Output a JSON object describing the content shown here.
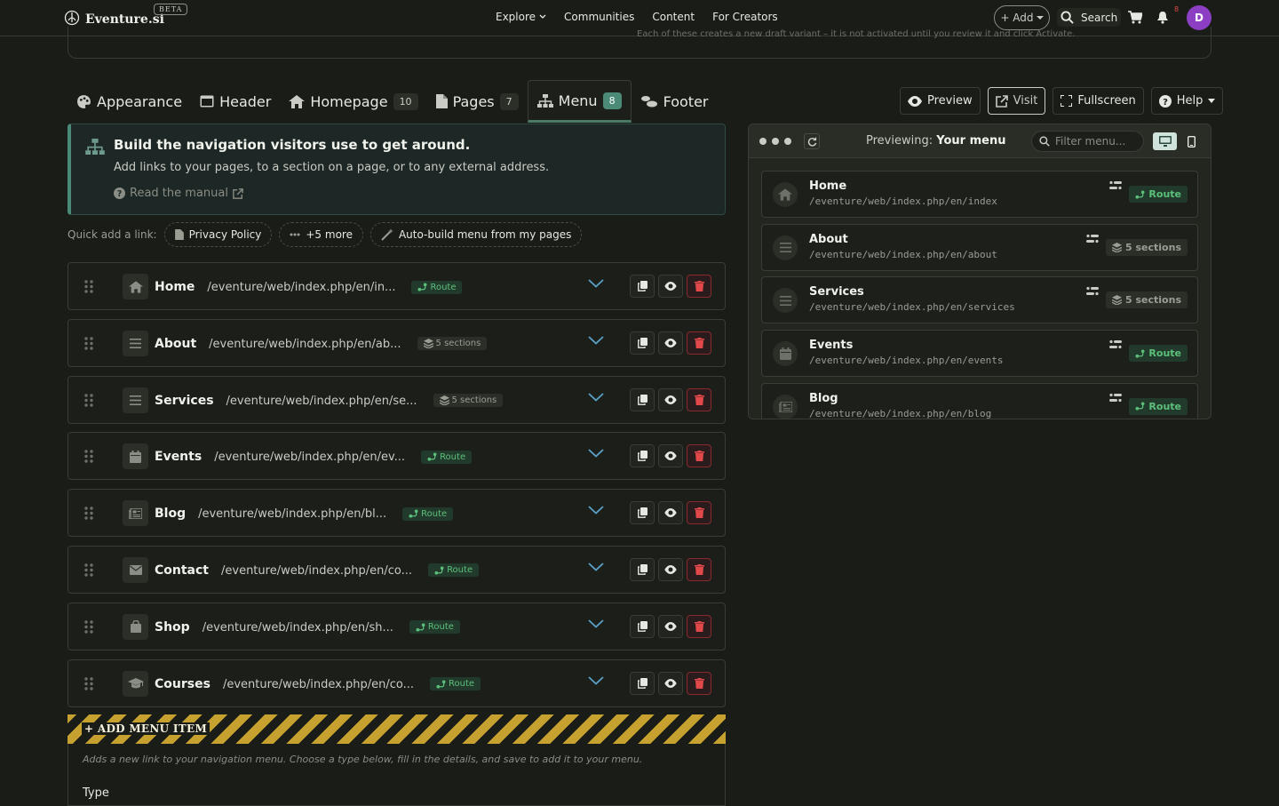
{
  "topnav": {
    "logo": "Eventure.si",
    "beta": "BETA",
    "links": [
      "Explore",
      "Communities",
      "Content",
      "For Creators"
    ],
    "add": "+ Add",
    "search": "Search",
    "notif_count": "8",
    "avatar": "D"
  },
  "topcard": {
    "text": "Each of these creates a new draft variant – it is not activated until you review it and click Activate."
  },
  "tabs": [
    {
      "label": "Appearance",
      "count": ""
    },
    {
      "label": "Header",
      "count": ""
    },
    {
      "label": "Homepage",
      "count": "10"
    },
    {
      "label": "Pages",
      "count": "7"
    },
    {
      "label": "Menu",
      "count": "8"
    },
    {
      "label": "Footer",
      "count": ""
    }
  ],
  "toolbar": {
    "preview": "Preview",
    "visit": "Visit",
    "fullscreen": "Fullscreen",
    "help": "Help"
  },
  "info": {
    "title": "Build the navigation visitors use to get around.",
    "subtitle": "Add links to your pages, to a section on a page, or to any external address.",
    "manual": "Read the manual"
  },
  "quick_add": {
    "label": "Quick add a link:",
    "privacy": "Privacy Policy",
    "more": "+5 more",
    "auto": "Auto-build menu from my pages"
  },
  "menu_items": [
    {
      "label": "Home",
      "path": "/eventure/web/index.php/en/in...",
      "badge": "Route",
      "type": "route",
      "icon": "home-icon"
    },
    {
      "label": "About",
      "path": "/eventure/web/index.php/en/ab...",
      "badge": "5 sections",
      "type": "sect",
      "icon": "list-icon"
    },
    {
      "label": "Services",
      "path": "/eventure/web/index.php/en/se...",
      "badge": "5 sections",
      "type": "sect",
      "icon": "list-icon"
    },
    {
      "label": "Events",
      "path": "/eventure/web/index.php/en/ev...",
      "badge": "Route",
      "type": "route",
      "icon": "calendar-icon"
    },
    {
      "label": "Blog",
      "path": "/eventure/web/index.php/en/bl...",
      "badge": "Route",
      "type": "route",
      "icon": "newspaper-icon"
    },
    {
      "label": "Contact",
      "path": "/eventure/web/index.php/en/co...",
      "badge": "Route",
      "type": "route",
      "icon": "envelope-icon"
    },
    {
      "label": "Shop",
      "path": "/eventure/web/index.php/en/sh...",
      "badge": "Route",
      "type": "route",
      "icon": "shopping-bag-icon"
    },
    {
      "label": "Courses",
      "path": "/eventure/web/index.php/en/co...",
      "badge": "Route",
      "type": "route",
      "icon": "graduation-cap-icon"
    }
  ],
  "add_item": {
    "label": "+ ADD MENU ITEM",
    "description": "Adds a new link to your navigation menu. Choose a type below, fill in the details, and save to add it to your menu.",
    "type_label": "Type"
  },
  "preview": {
    "prefix": "Previewing:",
    "target": "Your menu",
    "filter_placeholder": "Filter menu...",
    "items": [
      {
        "label": "Home",
        "path": "/eventure/web/index.php/en/index",
        "badge": "Route",
        "type": "route",
        "icon": "home-icon"
      },
      {
        "label": "About",
        "path": "/eventure/web/index.php/en/about",
        "badge": "5 sections",
        "type": "sect",
        "icon": "list-icon"
      },
      {
        "label": "Services",
        "path": "/eventure/web/index.php/en/services",
        "badge": "5 sections",
        "type": "sect",
        "icon": "list-icon"
      },
      {
        "label": "Events",
        "path": "/eventure/web/index.php/en/events",
        "badge": "Route",
        "type": "route",
        "icon": "calendar-icon"
      },
      {
        "label": "Blog",
        "path": "/eventure/web/index.php/en/blog",
        "badge": "Route",
        "type": "route",
        "icon": "newspaper-icon"
      }
    ]
  },
  "colors": {
    "accent": "#4a8a76",
    "route_green": "#5cc07a",
    "danger": "#e0484a",
    "hazard": "#c6a12f"
  }
}
